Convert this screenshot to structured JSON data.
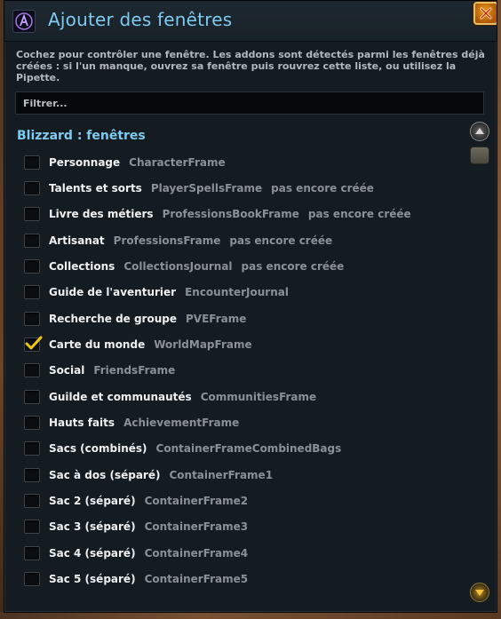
{
  "window": {
    "title": "Ajouter des fenêtres",
    "app_icon": "addon-logo-icon",
    "close_icon": "close-icon"
  },
  "description": "Cochez pour contrôler une fenêtre. Les addons sont détectés parmi les fenêtres déjà créées : si l'un manque, ouvrez sa fenêtre puis rouvrez cette liste, ou utilisez la Pipette.",
  "filter": {
    "placeholder": "Filtrer...",
    "value": ""
  },
  "section": {
    "title": "Blizzard : fenêtres"
  },
  "items": [
    {
      "label": "Personnage",
      "frame": "CharacterFrame",
      "status": "",
      "checked": false
    },
    {
      "label": "Talents et sorts",
      "frame": "PlayerSpellsFrame",
      "status": "pas encore créée",
      "checked": false
    },
    {
      "label": "Livre des métiers",
      "frame": "ProfessionsBookFrame",
      "status": "pas encore créée",
      "checked": false
    },
    {
      "label": "Artisanat",
      "frame": "ProfessionsFrame",
      "status": "pas encore créée",
      "checked": false
    },
    {
      "label": "Collections",
      "frame": "CollectionsJournal",
      "status": "pas encore créée",
      "checked": false
    },
    {
      "label": "Guide de l'aventurier",
      "frame": "EncounterJournal",
      "status": "",
      "checked": false
    },
    {
      "label": "Recherche de groupe",
      "frame": "PVEFrame",
      "status": "",
      "checked": false
    },
    {
      "label": "Carte du monde",
      "frame": "WorldMapFrame",
      "status": "",
      "checked": true
    },
    {
      "label": "Social",
      "frame": "FriendsFrame",
      "status": "",
      "checked": false
    },
    {
      "label": "Guilde et communautés",
      "frame": "CommunitiesFrame",
      "status": "",
      "checked": false
    },
    {
      "label": "Hauts faits",
      "frame": "AchievementFrame",
      "status": "",
      "checked": false
    },
    {
      "label": "Sacs (combinés)",
      "frame": "ContainerFrameCombinedBags",
      "status": "",
      "checked": false
    },
    {
      "label": "Sac à dos (séparé)",
      "frame": "ContainerFrame1",
      "status": "",
      "checked": false
    },
    {
      "label": "Sac 2 (séparé)",
      "frame": "ContainerFrame2",
      "status": "",
      "checked": false
    },
    {
      "label": "Sac 3 (séparé)",
      "frame": "ContainerFrame3",
      "status": "",
      "checked": false
    },
    {
      "label": "Sac 4 (séparé)",
      "frame": "ContainerFrame4",
      "status": "",
      "checked": false
    },
    {
      "label": "Sac 5 (séparé)",
      "frame": "ContainerFrame5",
      "status": "",
      "checked": false
    }
  ],
  "scrollbar": {
    "up_icon": "scroll-up-icon",
    "down_icon": "scroll-down-icon"
  },
  "colors": {
    "title": "#7ecaf0",
    "check": "#f0c814"
  }
}
